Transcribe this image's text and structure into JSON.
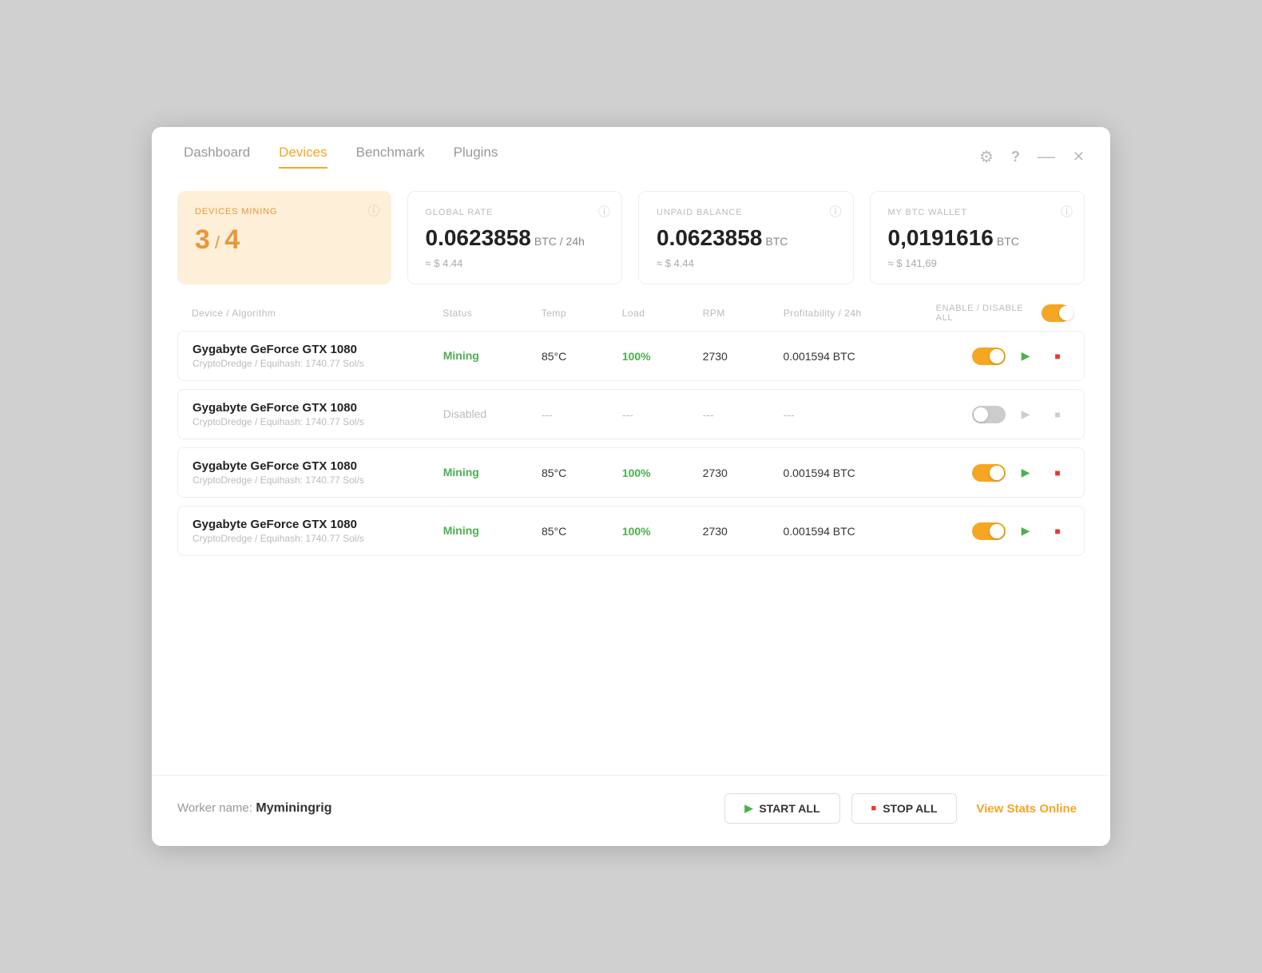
{
  "nav": {
    "tabs": [
      {
        "label": "Dashboard",
        "active": false
      },
      {
        "label": "Devices",
        "active": true
      },
      {
        "label": "Benchmark",
        "active": false
      },
      {
        "label": "Plugins",
        "active": false
      }
    ]
  },
  "window_controls": {
    "gear": "⚙",
    "help": "?",
    "minimize": "—",
    "close": "✕"
  },
  "stats": {
    "devices_mining": {
      "label": "DEVICES MINING",
      "value": "3",
      "slash": "/",
      "total": "4"
    },
    "global_rate": {
      "label": "GLOBAL RATE",
      "value": "0.0623858",
      "unit": "BTC / 24h",
      "sub": "≈ $ 4.44"
    },
    "unpaid_balance": {
      "label": "UNPAID BALANCE",
      "value": "0.0623858",
      "unit": "BTC",
      "sub": "≈ $ 4.44"
    },
    "btc_wallet": {
      "label": "MY BTC WALLET",
      "value": "0,0191616",
      "unit": "BTC",
      "sub": "≈ $ 141,69"
    }
  },
  "table": {
    "headers": {
      "device": "Device / Algorithm",
      "status": "Status",
      "temp": "Temp",
      "load": "Load",
      "rpm": "RPM",
      "profit": "Profitability / 24h",
      "enable_all": "ENABLE / DISABLE ALL"
    },
    "rows": [
      {
        "name": "Gygabyte GeForce GTX 1080",
        "algo": "CryptoDredge / Equihash: 1740.77 Sol/s",
        "status": "Mining",
        "status_type": "mining",
        "temp": "85°C",
        "load": "100%",
        "rpm": "2730",
        "profit": "0.001594 BTC",
        "enabled": true
      },
      {
        "name": "Gygabyte GeForce GTX 1080",
        "algo": "CryptoDredge / Equihash: 1740.77 Sol/s",
        "status": "Disabled",
        "status_type": "disabled",
        "temp": "---",
        "load": "---",
        "rpm": "---",
        "profit": "---",
        "enabled": false
      },
      {
        "name": "Gygabyte GeForce GTX 1080",
        "algo": "CryptoDredge / Equihash: 1740.77 Sol/s",
        "status": "Mining",
        "status_type": "mining",
        "temp": "85°C",
        "load": "100%",
        "rpm": "2730",
        "profit": "0.001594 BTC",
        "enabled": true
      },
      {
        "name": "Gygabyte GeForce GTX 1080",
        "algo": "CryptoDredge / Equihash: 1740.77 Sol/s",
        "status": "Mining",
        "status_type": "mining",
        "temp": "85°C",
        "load": "100%",
        "rpm": "2730",
        "profit": "0.001594 BTC",
        "enabled": true
      }
    ]
  },
  "footer": {
    "worker_prefix": "Worker name:",
    "worker_name": "Myminingrig",
    "btn_start_all": "START ALL",
    "btn_stop_all": "STOP ALL",
    "btn_view_stats": "View Stats Online"
  }
}
